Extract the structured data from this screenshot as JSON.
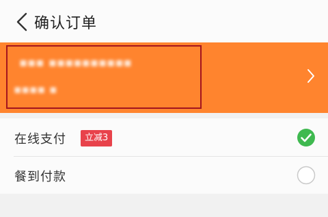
{
  "header": {
    "title": "确认订单",
    "back_icon": "chevron-left-icon"
  },
  "address": {
    "accent_color": "#ff842e",
    "chevron_icon": "chevron-right-icon"
  },
  "payment_options": [
    {
      "label": "在线支付",
      "badge": "立减3",
      "selected": true
    },
    {
      "label": "餐到付款",
      "selected": false
    }
  ],
  "colors": {
    "check": "#3fb950",
    "badge": "#e8424b"
  }
}
